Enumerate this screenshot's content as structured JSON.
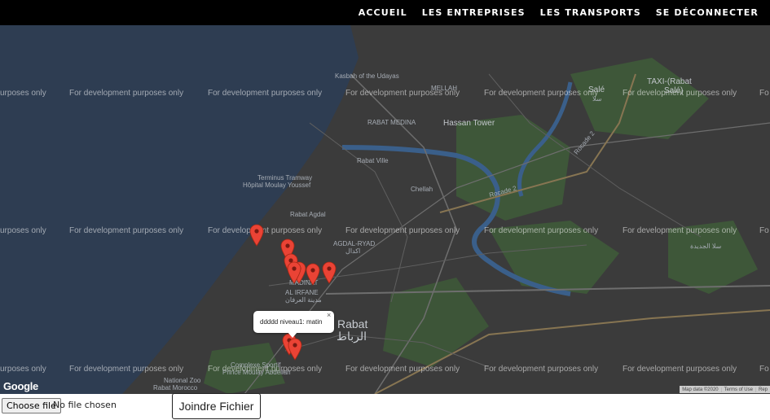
{
  "nav": {
    "items": [
      {
        "label": "ACCUEIL"
      },
      {
        "label": "LES ENTREPRISES"
      },
      {
        "label": "LES TRANSPORTS"
      },
      {
        "label": "SE DÉCONNECTER"
      }
    ]
  },
  "map": {
    "watermark": "For development purposes only",
    "watermark_edge": "urposes only",
    "watermark_edge_right": "Fo",
    "places": {
      "kasbah": "Kasbah of the Udayas",
      "rabat_medina": "RABAT MEDINA",
      "hassan_tower": "Hassan Tower",
      "sale": "Salé",
      "sale_ar": "سلا",
      "taxi": "TAXI-(Rabat",
      "taxi2": "Salé)",
      "rabat_ville": "Rabat Ville",
      "chellah": "Chellah",
      "terminus": "Terminus Tramway",
      "hopital": "Hôpital Moulay Youssef",
      "rabat_agdal": "Rabat Agdal",
      "agdal_ryad": "AGDAL-RYAD",
      "agdal_ryad_ar": "اكدال",
      "madinat": "MADINAT",
      "al_irfane": "AL IRFANE",
      "al_irfane_ar": "مدينة العرفان",
      "rabat": "Rabat",
      "rabat_ar": "الرباط",
      "complexe": "Complexe Sportif",
      "prince": "Prince Moulay Abdellah",
      "zoo": "National Zoo",
      "zoo2": "Rabat Morocco",
      "sala_jadida": "سلا الجديدة",
      "mellah": "MELLAH",
      "rocade": "Rocade 2",
      "rocade2": "Rocade 2"
    },
    "infowindow": {
      "text": "ddddd niveau1: matin",
      "close": "×"
    },
    "logo": "Google",
    "attribution": {
      "map_data": "Map data ©2020",
      "terms": "Terms of Use",
      "report": "Rep"
    },
    "colors": {
      "water": "#2e3d52",
      "land": "#3a3a3a",
      "park": "#3f5a3a",
      "river": "#3a5f8a",
      "road": "#6b6b6b",
      "highway": "#8a7a4a",
      "marker": "#ea4335"
    },
    "marker_icon": "map-pin-icon"
  },
  "upload": {
    "choose_label": "Choose file",
    "status": "No file chosen",
    "submit_label": "Joindre Fichier"
  }
}
